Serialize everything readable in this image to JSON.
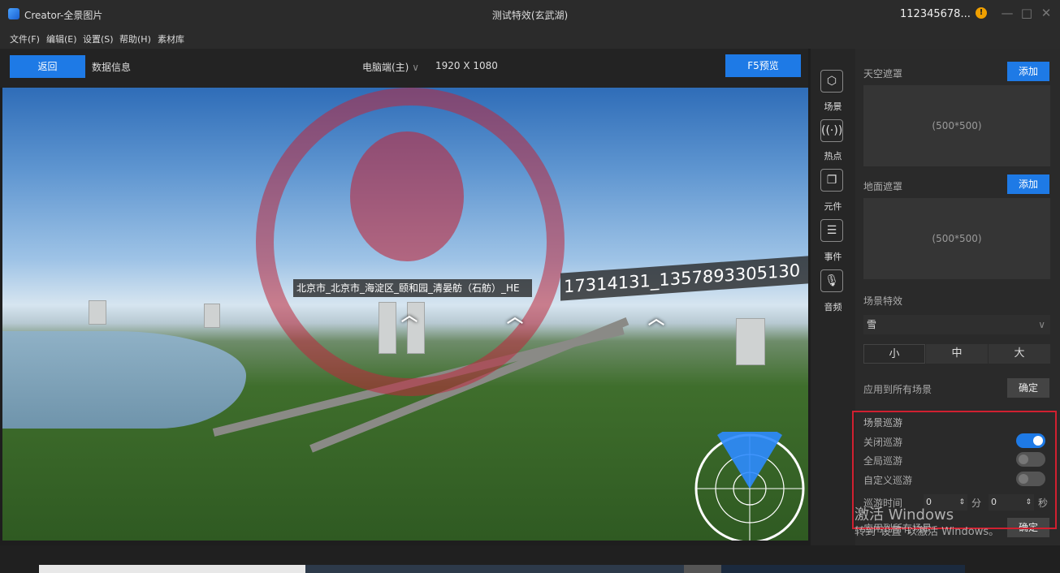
{
  "window": {
    "app_name": "Creator-全景图片",
    "title": "测试特效(玄武湖)",
    "user_id": "112345678...",
    "badge": "!"
  },
  "menu": [
    "文件(F)",
    "编辑(E)",
    "设置(S)",
    "帮助(H)",
    "素材库"
  ],
  "toolbar": {
    "back_label": "返回",
    "data_info_label": "数据信息",
    "device_label": "电脑端(主)",
    "resolution": "1920 X 1080",
    "preview_label": "F5预览"
  },
  "viewport": {
    "hotspot_text_1": "北京市_北京市_海淀区_颐和园_清晏舫（石舫）_HE",
    "hotspot_text_2": "17314131_1357893305130《",
    "chevron": "︿"
  },
  "side_tabs": [
    {
      "label": "场景",
      "icon": "cube-icon"
    },
    {
      "label": "热点",
      "icon": "broadcast-icon"
    },
    {
      "label": "元件",
      "icon": "layers-icon"
    },
    {
      "label": "事件",
      "icon": "list-icon"
    },
    {
      "label": "音频",
      "icon": "microphone-icon"
    }
  ],
  "panel": {
    "sky_mask_label": "天空遮罩",
    "add_label": "添加",
    "sky_size": "(500*500)",
    "ground_mask_label": "地面遮罩",
    "ground_size": "(500*500)",
    "effect_label": "场景特效",
    "effect_value": "雪",
    "sizes": [
      "小",
      "中",
      "大"
    ],
    "apply_all_label": "应用到所有场景",
    "confirm_label": "确定",
    "tour": {
      "title": "场景巡游",
      "close_tour": "关闭巡游",
      "global_tour": "全局巡游",
      "custom_tour": "自定义巡游",
      "tour_time": "巡游时间",
      "minutes_value": "0",
      "minutes_unit": "分",
      "seconds_value": "0",
      "seconds_unit": "秒",
      "apply_all_label": "应用到所有场景",
      "confirm_label": "确定"
    }
  },
  "watermark": {
    "line1": "激活 Windows",
    "line2": "转到\"设置\"以激活 Windows。"
  }
}
